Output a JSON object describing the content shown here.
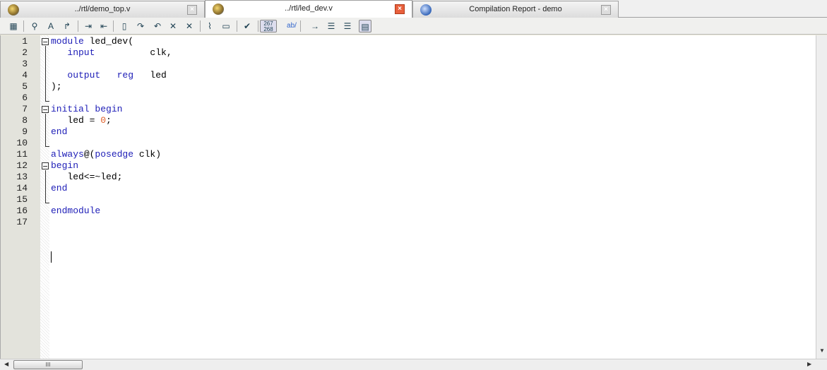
{
  "tabs": [
    {
      "label": "../rtl/demo_top.v",
      "icon": "verilog-file-icon",
      "active": false
    },
    {
      "label": "../rtl/led_dev.v",
      "icon": "verilog-file-icon",
      "active": true
    },
    {
      "label": "Compilation Report - demo",
      "icon": "report-icon",
      "active": false
    }
  ],
  "toolbar": {
    "line_numbers_label_top": "267",
    "line_numbers_label_bottom": "268",
    "ab_label": "ab/"
  },
  "colors": {
    "keyword": "#2020b8",
    "number": "#e0602a",
    "active_close": "#e8603c"
  },
  "editor": {
    "lines": [
      [
        {
          "t": "module",
          "k": "kw"
        },
        {
          "t": " led_dev("
        }
      ],
      [
        {
          "t": "   "
        },
        {
          "t": "input",
          "k": "kw"
        },
        {
          "t": "          clk,"
        }
      ],
      [
        {
          "t": ""
        }
      ],
      [
        {
          "t": "   "
        },
        {
          "t": "output",
          "k": "kw"
        },
        {
          "t": "   "
        },
        {
          "t": "reg",
          "k": "kw"
        },
        {
          "t": "   led"
        }
      ],
      [
        {
          "t": ");"
        }
      ],
      [
        {
          "t": ""
        }
      ],
      [
        {
          "t": "initial",
          "k": "kw"
        },
        {
          "t": " "
        },
        {
          "t": "begin",
          "k": "kw"
        }
      ],
      [
        {
          "t": "   led = "
        },
        {
          "t": "0",
          "k": "num"
        },
        {
          "t": ";"
        }
      ],
      [
        {
          "t": "end",
          "k": "kw"
        }
      ],
      [
        {
          "t": ""
        }
      ],
      [
        {
          "t": "always",
          "k": "kw"
        },
        {
          "t": "@("
        },
        {
          "t": "posedge",
          "k": "kw"
        },
        {
          "t": " clk)"
        }
      ],
      [
        {
          "t": "begin",
          "k": "kw"
        }
      ],
      [
        {
          "t": "   led<=~led;"
        }
      ],
      [
        {
          "t": "end",
          "k": "kw"
        }
      ],
      [
        {
          "t": ""
        }
      ],
      [
        {
          "t": "endmodule",
          "k": "kw"
        }
      ],
      [
        {
          "t": ""
        }
      ]
    ],
    "line_numbers": [
      "1",
      "2",
      "3",
      "4",
      "5",
      "6",
      "7",
      "8",
      "9",
      "10",
      "11",
      "12",
      "13",
      "14",
      "15",
      "16",
      "17"
    ]
  },
  "scrollbar": {
    "thumb_grip": "III"
  }
}
